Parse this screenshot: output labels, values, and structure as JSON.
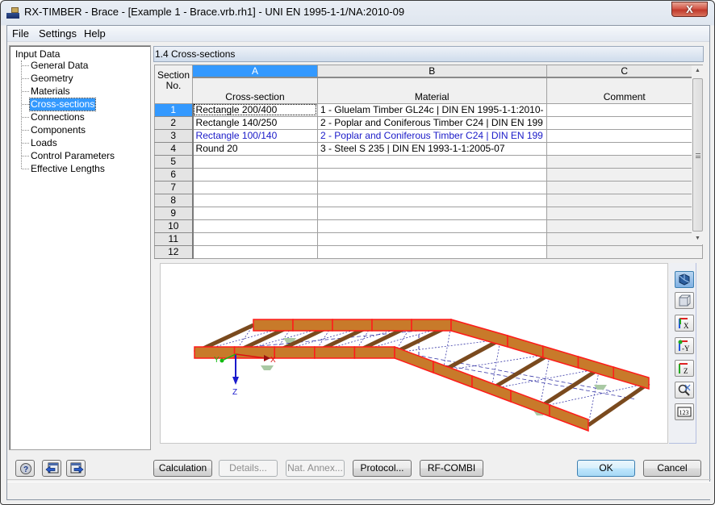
{
  "window": {
    "title": "RX-TIMBER - Brace - [Example 1 - Brace.vrb.rh1] - UNI EN 1995-1-1/NA:2010-09",
    "close_label": "X"
  },
  "menu": [
    "File",
    "Settings",
    "Help"
  ],
  "nav": {
    "root": "Input Data",
    "items": [
      {
        "label": "General Data",
        "selected": false
      },
      {
        "label": "Geometry",
        "selected": false
      },
      {
        "label": "Materials",
        "selected": false
      },
      {
        "label": "Cross-sections",
        "selected": true
      },
      {
        "label": "Connections",
        "selected": false
      },
      {
        "label": "Components",
        "selected": false
      },
      {
        "label": "Loads",
        "selected": false
      },
      {
        "label": "Control Parameters",
        "selected": false
      },
      {
        "label": "Effective Lengths",
        "selected": false
      }
    ]
  },
  "panel": {
    "title": "1.4 Cross-sections",
    "corner_header": [
      "Section",
      "No."
    ],
    "columns": [
      {
        "letter": "A",
        "label": "Cross-section",
        "active": true
      },
      {
        "letter": "B",
        "label": "Material",
        "active": false
      },
      {
        "letter": "C",
        "label": "Comment",
        "active": false
      }
    ],
    "rows": [
      {
        "no": "1",
        "cross_section": "Rectangle 200/400",
        "material": "1 - Gluelam Timber GL24c | DIN EN 1995-1-1:2010-",
        "comment": "",
        "active": true,
        "highlight": false
      },
      {
        "no": "2",
        "cross_section": "Rectangle 140/250",
        "material": "2 - Poplar and Coniferous Timber C24 | DIN EN 199",
        "comment": "",
        "active": false,
        "highlight": false
      },
      {
        "no": "3",
        "cross_section": "Rectangle 100/140",
        "material": "2 - Poplar and Coniferous Timber C24 | DIN EN 199",
        "comment": "",
        "active": false,
        "highlight": true
      },
      {
        "no": "4",
        "cross_section": "Round 20",
        "material": "3 - Steel S 235 | DIN EN 1993-1-1:2005-07",
        "comment": "",
        "active": false,
        "highlight": false
      },
      {
        "no": "5",
        "cross_section": "",
        "material": "",
        "comment": "",
        "active": false,
        "highlight": false
      },
      {
        "no": "6",
        "cross_section": "",
        "material": "",
        "comment": "",
        "active": false,
        "highlight": false
      },
      {
        "no": "7",
        "cross_section": "",
        "material": "",
        "comment": "",
        "active": false,
        "highlight": false
      },
      {
        "no": "8",
        "cross_section": "",
        "material": "",
        "comment": "",
        "active": false,
        "highlight": false
      },
      {
        "no": "9",
        "cross_section": "",
        "material": "",
        "comment": "",
        "active": false,
        "highlight": false
      },
      {
        "no": "10",
        "cross_section": "",
        "material": "",
        "comment": "",
        "active": false,
        "highlight": false
      },
      {
        "no": "11",
        "cross_section": "",
        "material": "",
        "comment": "",
        "active": false,
        "highlight": false
      },
      {
        "no": "12",
        "cross_section": "",
        "material": "",
        "comment": "",
        "active": false,
        "highlight": false
      }
    ]
  },
  "view": {
    "axis_labels": {
      "x": "X",
      "y": "Y",
      "z": "Z"
    },
    "colors": {
      "beam_fill": "#c87a2a",
      "beam_outline": "#ff1a1a",
      "brace_dark": "#7a4a1e",
      "bracing": "#3a3aa8",
      "support": "#a9c9a4"
    }
  },
  "toolbar_right": [
    {
      "name": "iso-view-icon",
      "active": true
    },
    {
      "name": "wireframe-view-icon",
      "active": false
    },
    {
      "name": "view-x-icon",
      "label": "X",
      "active": false
    },
    {
      "name": "view-minus-y-icon",
      "label": "-Y",
      "active": false
    },
    {
      "name": "view-z-icon",
      "label": "Z",
      "active": false
    },
    {
      "name": "zoom-all-icon",
      "active": false
    },
    {
      "name": "numbering-icon",
      "label": "123",
      "active": false
    }
  ],
  "buttons": {
    "calculation": "Calculation",
    "details": "Details...",
    "nat_annex": "Nat. Annex...",
    "protocol": "Protocol...",
    "rf_combi": "RF-COMBI",
    "ok": "OK",
    "cancel": "Cancel"
  }
}
